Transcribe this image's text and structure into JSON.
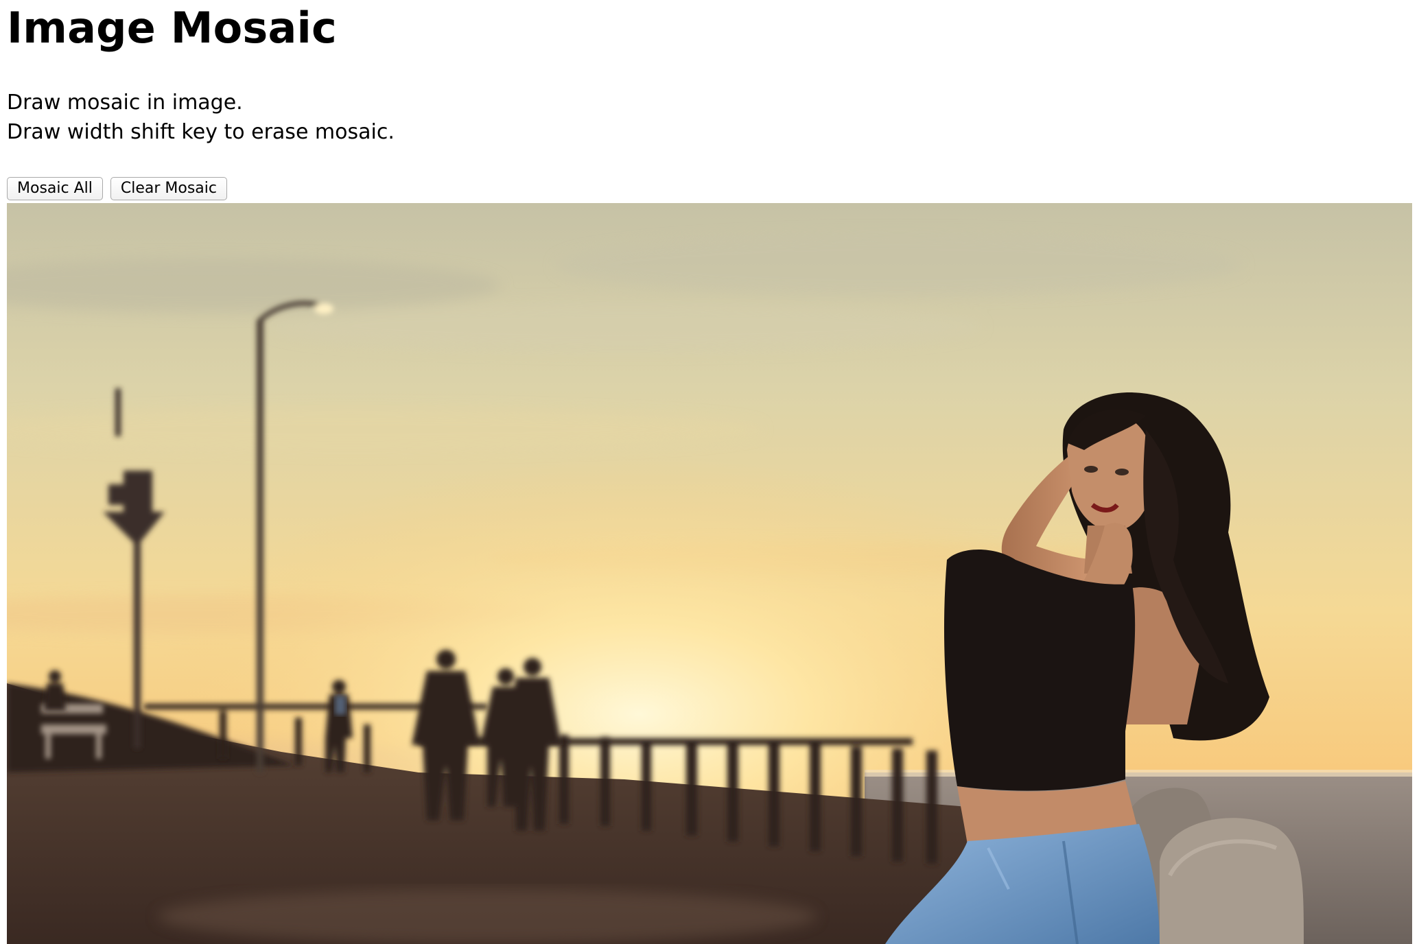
{
  "page": {
    "title": "Image Mosaic",
    "description": [
      "Draw mosaic in image.",
      "Draw width shift key to erase mosaic."
    ]
  },
  "toolbar": {
    "mosaic_all_label": "Mosaic All",
    "clear_mosaic_label": "Clear Mosaic"
  },
  "canvas": {
    "image": "sunset-boardwalk-photo",
    "colors": {
      "sky_top": "#c9c5a9",
      "sky_mid": "#f3d48f",
      "sun_glow": "#fff3c8",
      "horizon": "#f7c877",
      "ground": "#4a352b",
      "silhouette": "#2b211c",
      "skin": "#c08662",
      "hair": "#1e1511",
      "top": "#1b1412",
      "jeans": "#6f9ccc"
    }
  }
}
